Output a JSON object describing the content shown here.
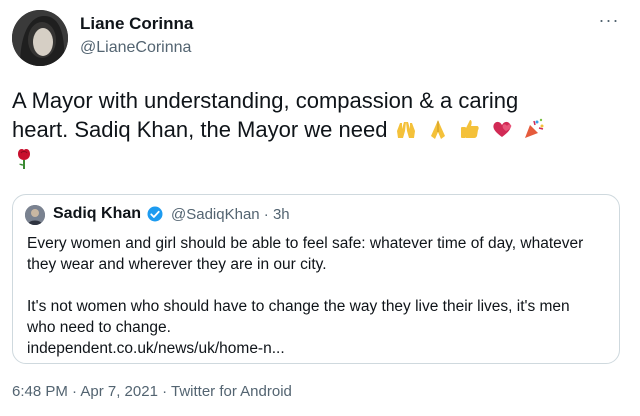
{
  "author": {
    "name": "Liane Corinna",
    "handle": "@LianeCorinna"
  },
  "tweet": {
    "text_line1": "A Mayor with understanding, compassion & a caring",
    "text_line2": "heart. Sadiq Khan, the Mayor we need",
    "emojis": [
      "raising-hands-icon",
      "folded-hands-icon",
      "thumbs-up-icon",
      "heart-icon",
      "party-popper-icon",
      "rose-icon"
    ],
    "more_label": "···"
  },
  "quoted": {
    "name": "Sadiq Khan",
    "handle_time": "@SadiqKhan · 3h",
    "verified": true,
    "para1_line1": "Every women and girl should be able to feel safe: whatever time of day, whatever",
    "para1_line2": "they wear and wherever they are in our city.",
    "para2_line1": "It's not women who should have to change the way they live their lives, it's men",
    "para2_line2": "who need to change.",
    "link": "independent.co.uk/news/uk/home-n..."
  },
  "footer": {
    "meta": "6:48 PM · Apr 7, 2021 · Twitter for Android"
  },
  "colors": {
    "text": "#0f1419",
    "muted": "#536471",
    "border": "#cfd9de",
    "verified": "#1d9bf0"
  }
}
